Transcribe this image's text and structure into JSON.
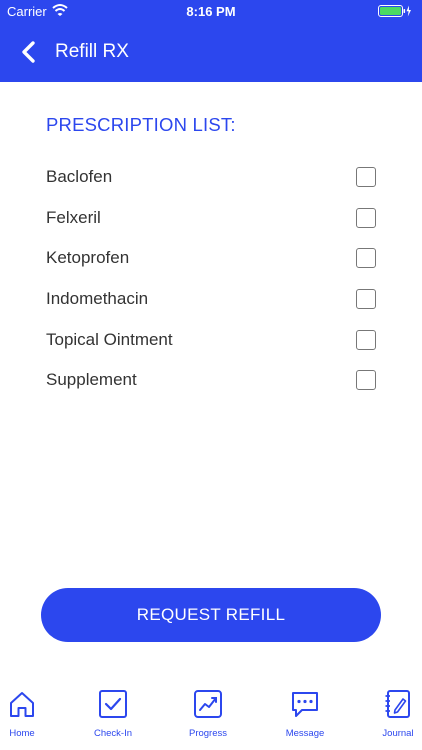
{
  "status_bar": {
    "carrier": "Carrier",
    "time": "8:16 PM"
  },
  "header": {
    "title": "Refill RX"
  },
  "prescription": {
    "title": "PRESCRIPTION LIST:",
    "items": [
      {
        "label": "Baclofen",
        "checked": false
      },
      {
        "label": "Felxeril",
        "checked": false
      },
      {
        "label": "Ketoprofen",
        "checked": false
      },
      {
        "label": "Indomethacin",
        "checked": false
      },
      {
        "label": "Topical Ointment",
        "checked": false
      },
      {
        "label": "Supplement",
        "checked": false
      }
    ]
  },
  "actions": {
    "request_refill": "REQUEST REFILL"
  },
  "tabs": [
    {
      "label": "Home",
      "icon": "home-icon"
    },
    {
      "label": "Check-In",
      "icon": "checkbox-icon"
    },
    {
      "label": "Progress",
      "icon": "trend-chart-icon"
    },
    {
      "label": "Message",
      "icon": "chat-bubble-icon"
    },
    {
      "label": "Journal",
      "icon": "notebook-pen-icon"
    }
  ],
  "colors": {
    "accent": "#2c47ee",
    "battery": "#4cd964"
  }
}
